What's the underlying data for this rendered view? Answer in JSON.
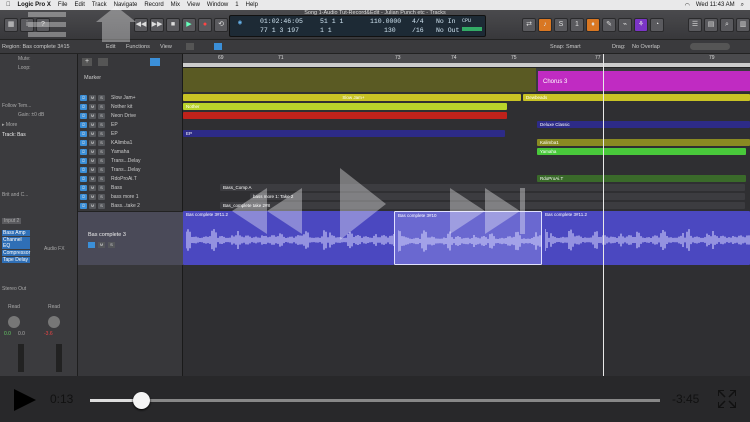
{
  "menubar": {
    "app": "Logic Pro X",
    "items": [
      "File",
      "Edit",
      "Track",
      "Navigate",
      "Record",
      "Mix",
      "View",
      "Window",
      "1",
      "Help"
    ],
    "right": [
      "Wed 11:43 AM"
    ]
  },
  "toolbar": {
    "window_title": "Song 1-Audio Tut-Record&Edit - Julian Punch etc - Tracks",
    "lcd_position": "01:02:46:05",
    "lcd_bar": "77  1  3  197",
    "lcd_mid1": "51  1  1",
    "lcd_mid2": "1  1",
    "lcd_tempo": "110.0000",
    "lcd_tempo2": "130",
    "lcd_sig": "4/4",
    "lcd_div": "/16",
    "lcd_in": "No In",
    "lcd_out": "No Out",
    "lcd_cpu": "CPU"
  },
  "subbar": {
    "region_label": "Region: Bas complete 3#15",
    "edit": "Edit",
    "functions": "Functions",
    "view": "View",
    "snap_label": "Snap:",
    "snap_value": "Smart",
    "drag_label": "Drag:",
    "drag_value": "No Overlap"
  },
  "inspector": {
    "mute": "Mute:",
    "loop": "Loop:",
    "follow_tempo": "Follow Tem...",
    "gain": "Gain: ±0 dB",
    "more": "▸ More",
    "track_label": "Track: Bas",
    "brit_label": "Brit and C...",
    "input": "Input 2",
    "stereo_out": "Stereo Out",
    "read1": "Read",
    "read2": "Read",
    "val1": "0.0",
    "val2": "0.0",
    "val3": "-3.6",
    "plugins": [
      "Bass Amp",
      "Channel EQ",
      "Compressor",
      "Tape Delay"
    ],
    "audio_fx": "Audio FX"
  },
  "ruler": [
    "69",
    "71",
    "73",
    "74",
    "75",
    "77",
    "79"
  ],
  "marker_label": "Marker",
  "tracks": [
    {
      "name": "Slow Jam+",
      "mute": "M",
      "solo": "S"
    },
    {
      "name": "Nother kit",
      "mute": "M",
      "solo": "S"
    },
    {
      "name": "Neon Drive",
      "mute": "M",
      "solo": "S"
    },
    {
      "name": "EP",
      "mute": "M",
      "solo": "S"
    },
    {
      "name": "EP",
      "mute": "M",
      "solo": "S"
    },
    {
      "name": "KAlimba1",
      "mute": "M",
      "solo": "S"
    },
    {
      "name": "Yamaha",
      "mute": "M",
      "solo": "S"
    },
    {
      "name": "Trans...Delay",
      "mute": "M",
      "solo": "S"
    },
    {
      "name": "Trans...Delay",
      "mute": "M",
      "solo": "S"
    },
    {
      "name": "RdoProAi.T",
      "mute": "M",
      "solo": "S"
    },
    {
      "name": "Bass",
      "mute": "M",
      "solo": "S"
    },
    {
      "name": "bass more 1",
      "mute": "M",
      "solo": "S"
    },
    {
      "name": "Bass...take 2",
      "mute": "M",
      "solo": "S"
    },
    {
      "name": "Bas complete 3",
      "mute": "M",
      "solo": "S"
    }
  ],
  "regions": {
    "chorus": "Chorus 3",
    "slow_jam": "Slow Jam+",
    "dewbeads": "Dewbeads",
    "deluxe_classic": "Deluxe Classic",
    "kalimba": "Kalimba1",
    "yamaha": "Yamaha",
    "rdopro": "RdoProAi.T",
    "ep": "EP",
    "nother": "Nother",
    "bass_comp": "Bass_Comp A",
    "bass_more": "bass more 1: Take 2",
    "bas_comp_take": "Bas_complete take 2#8",
    "bas_complete_1": "Bas complete 3#11.2",
    "bas_complete_2": "Bas complete 3#10",
    "bas_complete_3": "Bas complete 3#11.2"
  },
  "video": {
    "current_time": "0:13",
    "remaining_time": "-3:45",
    "progress": 0.09
  },
  "colors": {
    "yellow": "#c9c325",
    "lime": "#b9d32a",
    "red": "#c0221b",
    "purple_dark": "#2d2b88",
    "magenta": "#c02bc2",
    "green": "#49c93b",
    "olive": "#8a8a22",
    "bass_blue": "#4b48c0"
  }
}
